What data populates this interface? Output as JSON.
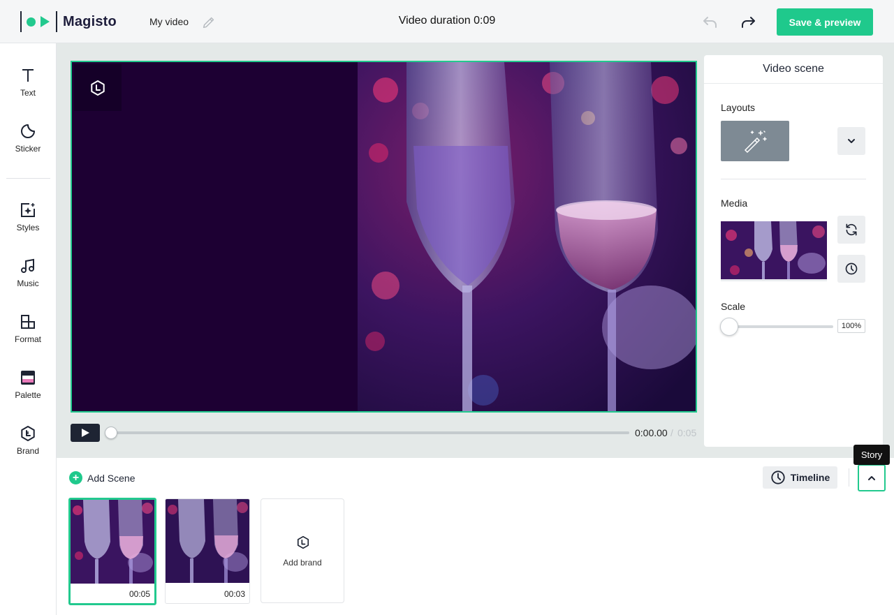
{
  "header": {
    "logo_text": "Magisto",
    "video_name": "My video",
    "duration": "Video duration 0:09",
    "save_label": "Save & preview"
  },
  "sidebar": {
    "items": [
      {
        "label": "Text",
        "icon": "text-icon"
      },
      {
        "label": "Sticker",
        "icon": "sticker-icon"
      },
      {
        "label": "Styles",
        "icon": "styles-icon"
      },
      {
        "label": "Music",
        "icon": "music-icon"
      },
      {
        "label": "Format",
        "icon": "format-icon"
      },
      {
        "label": "Palette",
        "icon": "palette-icon"
      },
      {
        "label": "Brand",
        "icon": "brand-icon"
      }
    ]
  },
  "player": {
    "current_time": "0:00.00",
    "separator": "/",
    "total_time": "0:05"
  },
  "panel": {
    "title": "Video scene",
    "layouts_label": "Layouts",
    "media_label": "Media",
    "scale_label": "Scale",
    "scale_value": "100%",
    "scale_fraction": 0
  },
  "bottom": {
    "add_scene_label": "Add Scene",
    "timeline_label": "Timeline",
    "story_tooltip": "Story",
    "scenes": [
      {
        "duration": "00:05",
        "selected": true
      },
      {
        "duration": "00:03",
        "selected": false
      }
    ],
    "add_brand_label": "Add brand"
  },
  "colors": {
    "accent": "#1fc98c",
    "dark": "#1e2433",
    "stage_bg": "#1d0033"
  }
}
